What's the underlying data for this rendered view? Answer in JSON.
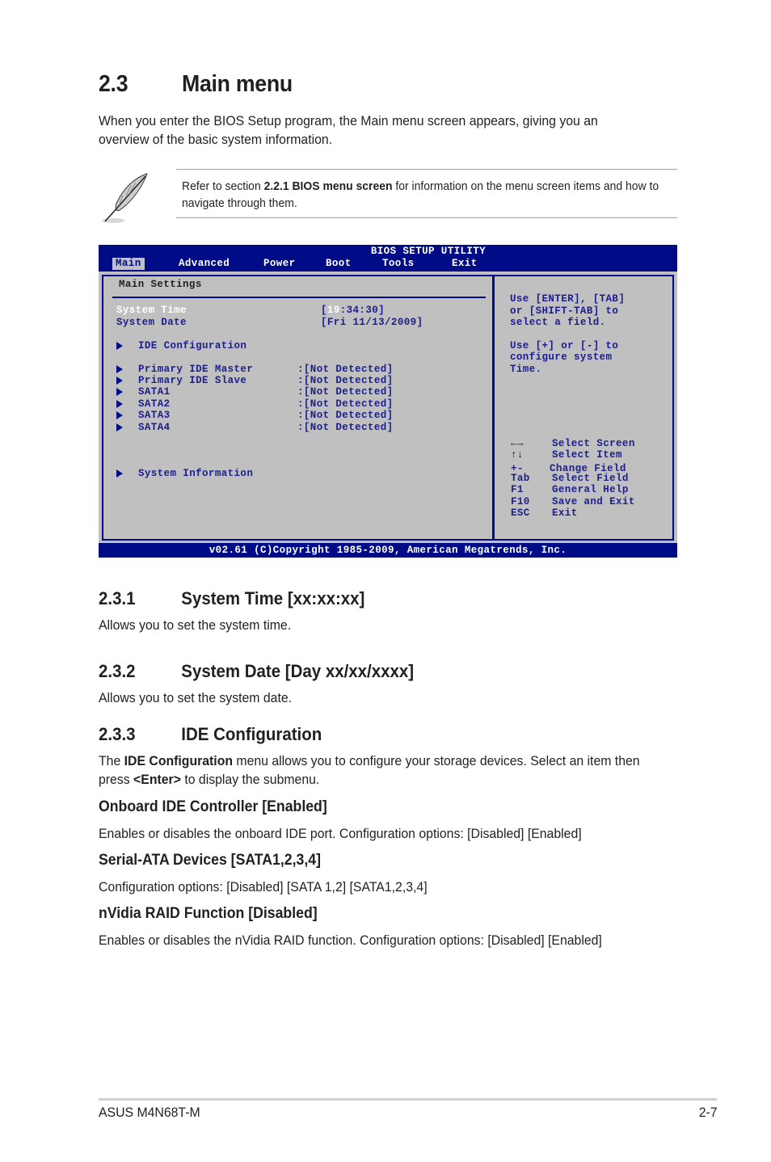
{
  "section": {
    "number": "2.3",
    "title": "Main menu",
    "intro": "When you enter the BIOS Setup program, the Main menu screen appears, giving you an overview of the basic system information."
  },
  "note": {
    "icon": "feather-pen-icon",
    "prefix": "Refer to section ",
    "bold": "2.2.1 BIOS menu screen",
    "suffix": " for information on the menu screen items and how to navigate through them."
  },
  "bios": {
    "title": "BIOS SETUP UTILITY",
    "tabs": [
      "Main",
      "Advanced",
      "Power",
      "Boot",
      "Tools",
      "Exit"
    ],
    "active_tab": "Main",
    "panel_title": "Main Settings",
    "system_time": {
      "label": "System Time",
      "value_open": "[",
      "value_hl": "19",
      "value_rest": ":34:30]"
    },
    "system_date": {
      "label": "System Date",
      "value": "[Fri 11/13/2009]"
    },
    "ide_config": "IDE Configuration",
    "devices": [
      {
        "label": "Primary IDE Master",
        "value": ":[Not Detected]"
      },
      {
        "label": "Primary IDE Slave",
        "value": ":[Not Detected]"
      },
      {
        "label": "SATA1",
        "value": ":[Not Detected]"
      },
      {
        "label": "SATA2",
        "value": ":[Not Detected]"
      },
      {
        "label": "SATA3",
        "value": ":[Not Detected]"
      },
      {
        "label": "SATA4",
        "value": ":[Not Detected]"
      }
    ],
    "system_info": "System Information",
    "help": [
      "Use [ENTER], [TAB]",
      "or [SHIFT-TAB] to",
      "select a field.",
      "",
      "Use [+] or [-] to",
      "configure system",
      "Time."
    ],
    "keys": [
      {
        "key": "←→",
        "desc": "Select Screen"
      },
      {
        "key": "↑↓",
        "desc": "Select Item"
      },
      {
        "key": "+-",
        "desc": "Change Field"
      },
      {
        "key": "Tab",
        "desc": "Select Field"
      },
      {
        "key": "F1",
        "desc": "General Help"
      },
      {
        "key": "F10",
        "desc": "Save and Exit"
      },
      {
        "key": "ESC",
        "desc": "Exit"
      }
    ],
    "footer": "v02.61 (C)Copyright 1985-2009, American Megatrends, Inc.",
    "colors": {
      "frame": "#000c87",
      "background": "#c0c0c0",
      "text": "#1b1e8c",
      "highlight": "#ffffff"
    }
  },
  "sub1": {
    "number": "2.3.1",
    "title": "System Time [xx:xx:xx]",
    "desc": "Allows you to set the system time."
  },
  "sub2": {
    "number": "2.3.2",
    "title": "System Date [Day xx/xx/xxxx]",
    "desc": "Allows you to set the system date."
  },
  "sub3": {
    "number": "2.3.3",
    "title": "IDE Configuration",
    "p_pre": "The ",
    "p_bold1": "IDE Configuration",
    "p_mid": " menu allows you to configure your storage devices. Select an item then press ",
    "p_bold2": "<Enter>",
    "p_post": " to display the submenu.",
    "items": [
      {
        "title": "Onboard IDE Controller [Enabled]",
        "desc": "Enables or disables the onboard IDE port. Configuration options: [Disabled] [Enabled]"
      },
      {
        "title": "Serial-ATA Devices [SATA1,2,3,4]",
        "desc": "Configuration options: [Disabled] [SATA 1,2] [SATA1,2,3,4]"
      },
      {
        "title": "nVidia RAID Function [Disabled]",
        "desc": "Enables or disables the nVidia RAID function. Configuration options: [Disabled] [Enabled]"
      }
    ]
  },
  "footer": {
    "left": "ASUS M4N68T-M",
    "right": "2-7"
  }
}
